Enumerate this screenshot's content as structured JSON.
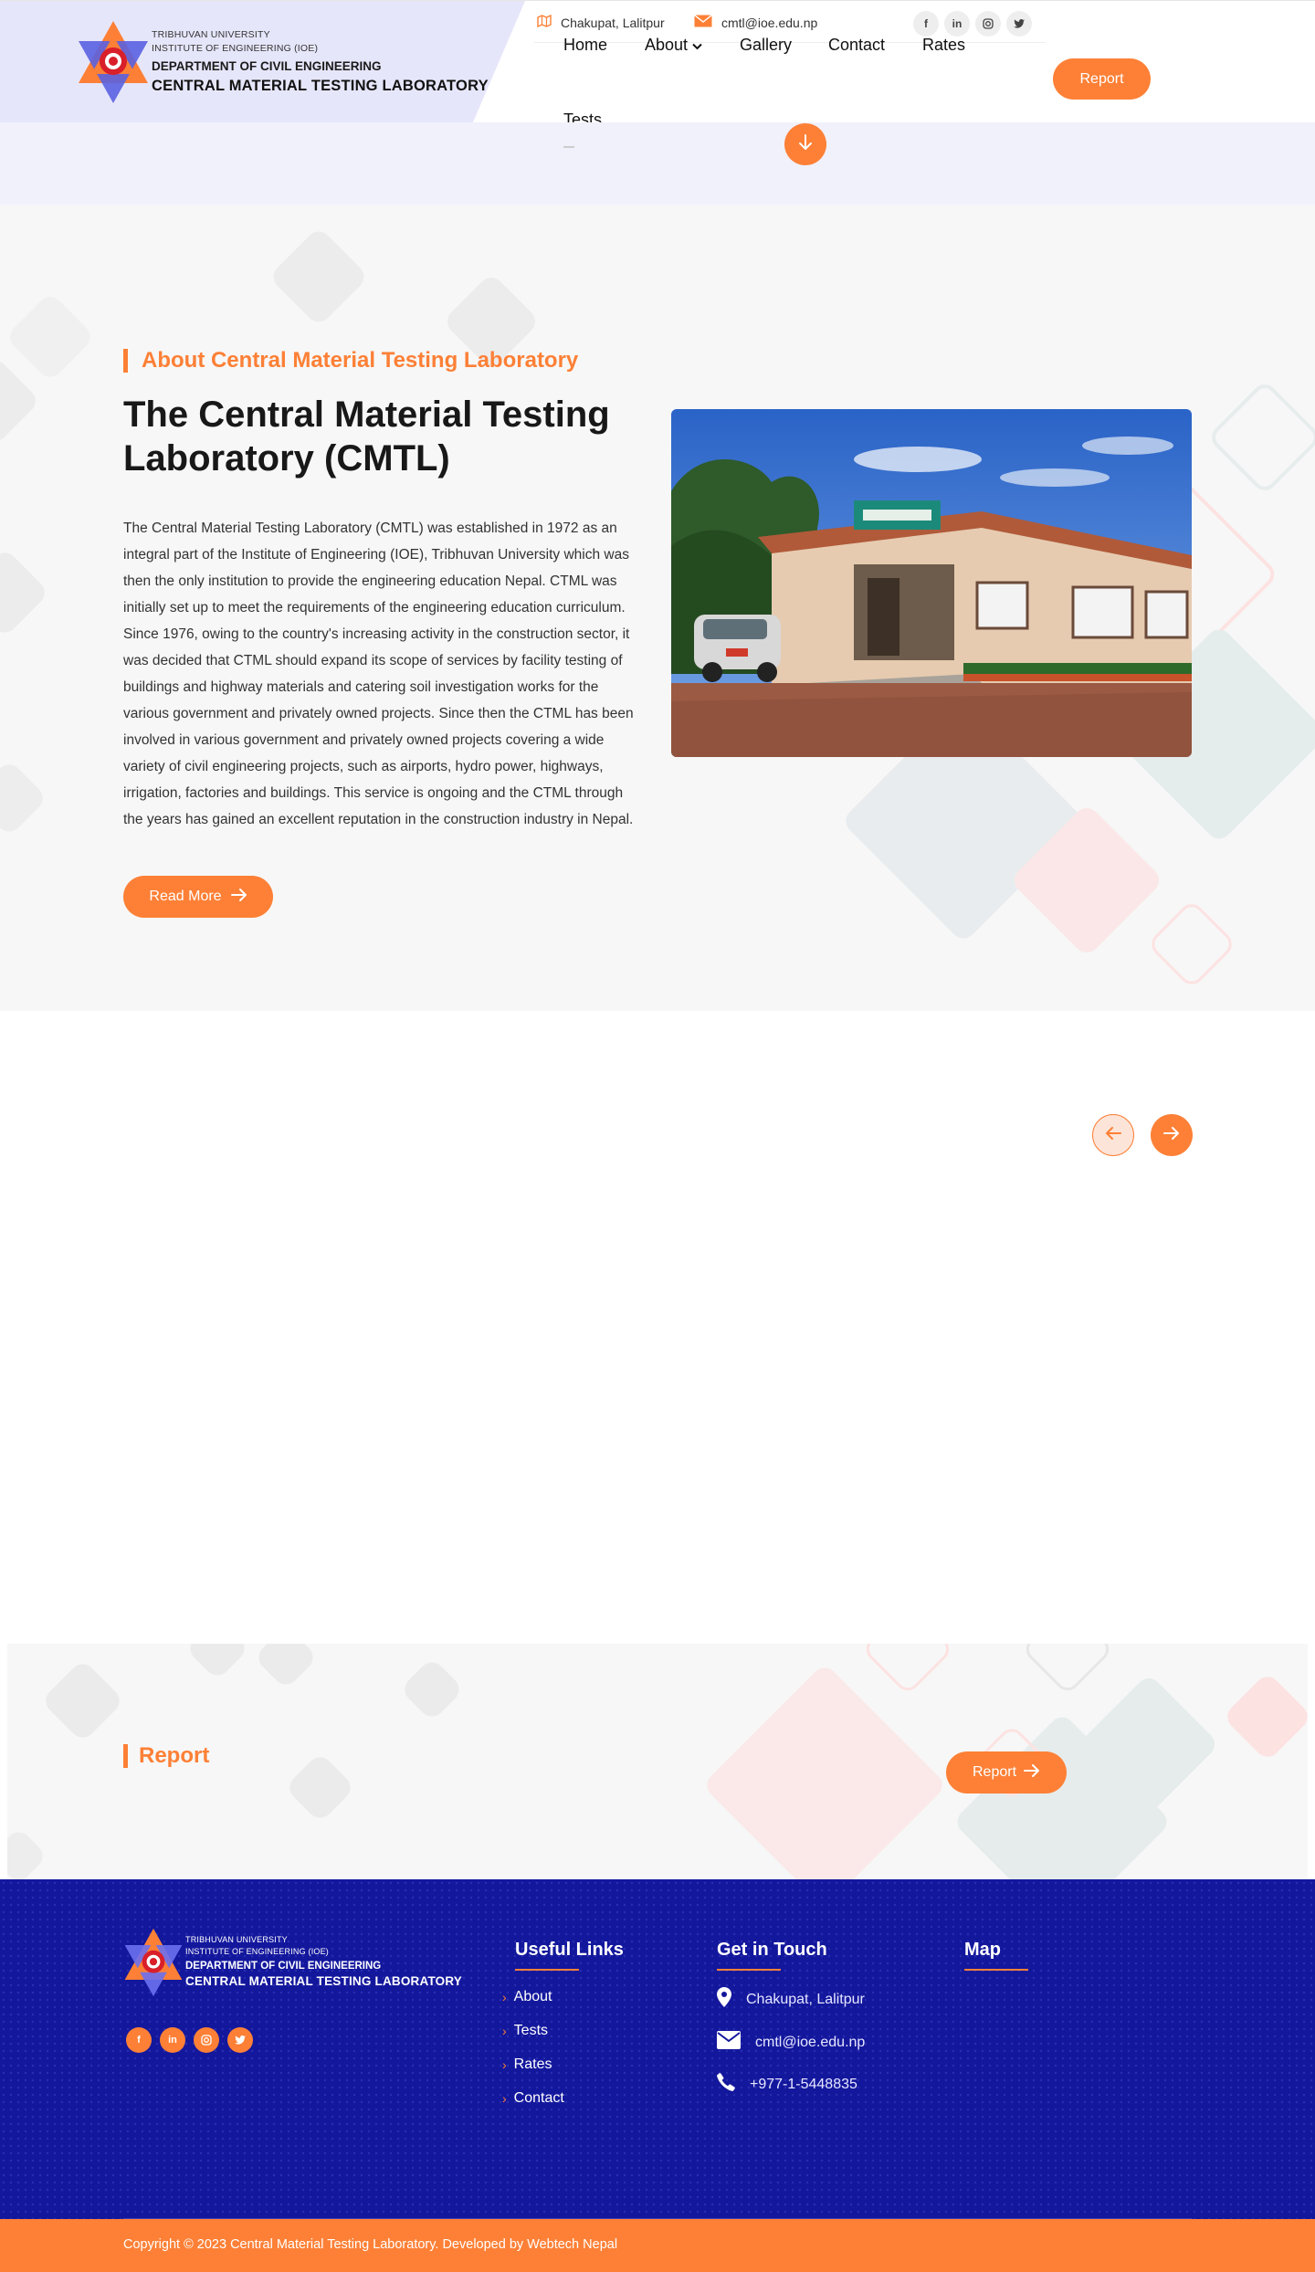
{
  "brand": {
    "university": "TRIBHUVAN UNIVERSITY",
    "institute": "INSTITUTE OF ENGINEERING (IOE)",
    "department": "DEPARTMENT OF CIVIL ENGINEERING",
    "lab": "CENTRAL MATERIAL TESTING LABORATORY"
  },
  "topbar": {
    "address": "Chakupat, Lalitpur",
    "email": "cmtl@ioe.edu.np",
    "address_icon": "map-icon",
    "email_icon": "envelope-icon",
    "social": [
      "f",
      "in",
      "ig",
      "tw"
    ]
  },
  "nav": {
    "items": [
      {
        "label": "Home"
      },
      {
        "label": "About",
        "dropdown": true
      },
      {
        "label": "Gallery"
      },
      {
        "label": "Contact"
      },
      {
        "label": "Rates"
      },
      {
        "label": "Tests"
      }
    ],
    "report_button": "Report"
  },
  "about": {
    "eyebrow": "About Central Material Testing Laboratory",
    "title": "The Central Material Testing Laboratory (CMTL)",
    "body": "The Central Material Testing Laboratory (CMTL) was established in 1972 as an integral part of the Institute of Engineering (IOE), Tribhuvan University which was then the only institution to provide the engineering education Nepal. CTML was initially set up to meet the requirements of the engineering education curriculum. Since 1976, owing to the country's increasing activity in the construction sector, it was decided that CTML should expand its scope of services by facility testing of buildings and highway materials and catering soil investigation works for the various government and privately owned projects. Since then the CTML has been involved in various government and privately owned projects covering a wide variety of civil engineering projects, such as airports, hydro power, highways, irrigation, factories and buildings. This service is ongoing and the CTML through the years has gained an excellent reputation in the construction industry in Nepal.",
    "read_more": "Read More"
  },
  "report": {
    "eyebrow": "Report",
    "button": "Report"
  },
  "footer": {
    "social": [
      "f",
      "in",
      "ig",
      "tw"
    ],
    "useful_links_heading": "Useful Links",
    "links": [
      "About",
      "Tests",
      "Rates",
      "Contact"
    ],
    "contact_heading": "Get in Touch",
    "contact": {
      "address": "Chakupat, Lalitpur",
      "email": "cmtl@ioe.edu.np",
      "phone": "+977-1-5448835"
    },
    "map_heading": "Map",
    "copyright": "Copyright © 2023 Central Material Testing Laboratory. Developed by Webtech Nepal"
  },
  "colors": {
    "accent": "#fd8036",
    "footer_bg": "#13179c",
    "header_tint": "#e6e6fb"
  }
}
